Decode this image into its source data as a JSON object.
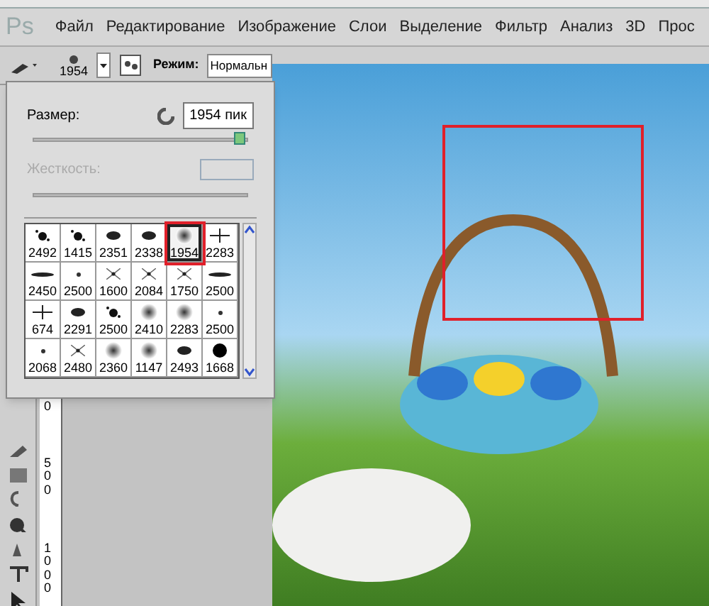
{
  "app_logo": "Ps",
  "menu": [
    "Файл",
    "Редактирование",
    "Изображение",
    "Слои",
    "Выделение",
    "Фильтр",
    "Анализ",
    "3D",
    "Прос"
  ],
  "options_bar": {
    "brush_size": "1954",
    "mode_label": "Режим:",
    "mode_value": "Нормальн"
  },
  "brush_panel": {
    "size_label": "Размер:",
    "size_value": "1954 пик",
    "size_slider": {
      "level": 0.98
    },
    "hardness_label": "Жесткость:",
    "hardness_disabled": true,
    "brushes": [
      {
        "size": "2492",
        "kind": "splat",
        "selected": false
      },
      {
        "size": "1415",
        "kind": "splat",
        "selected": false
      },
      {
        "size": "2351",
        "kind": "blob",
        "selected": false
      },
      {
        "size": "2338",
        "kind": "blob",
        "selected": false
      },
      {
        "size": "1954",
        "kind": "soft",
        "selected": true
      },
      {
        "size": "2283",
        "kind": "cross",
        "selected": false
      },
      {
        "size": "2450",
        "kind": "streak",
        "selected": false
      },
      {
        "size": "2500",
        "kind": "dot",
        "selected": false
      },
      {
        "size": "1600",
        "kind": "star",
        "selected": false
      },
      {
        "size": "2084",
        "kind": "star",
        "selected": false
      },
      {
        "size": "1750",
        "kind": "star",
        "selected": false
      },
      {
        "size": "2500",
        "kind": "streak",
        "selected": false
      },
      {
        "size": "674",
        "kind": "cross",
        "selected": false
      },
      {
        "size": "2291",
        "kind": "blob",
        "selected": false
      },
      {
        "size": "2500",
        "kind": "splat",
        "selected": false
      },
      {
        "size": "2410",
        "kind": "soft",
        "selected": false
      },
      {
        "size": "2283",
        "kind": "soft",
        "selected": false
      },
      {
        "size": "2500",
        "kind": "dot",
        "selected": false
      },
      {
        "size": "2068",
        "kind": "dot",
        "selected": false
      },
      {
        "size": "2480",
        "kind": "star",
        "selected": false
      },
      {
        "size": "2360",
        "kind": "soft",
        "selected": false
      },
      {
        "size": "1147",
        "kind": "soft",
        "selected": false
      },
      {
        "size": "2493",
        "kind": "blob",
        "selected": false
      },
      {
        "size": "1668",
        "kind": "hard",
        "selected": false
      }
    ]
  },
  "ruler_labels": [
    "0",
    "500",
    "1000"
  ]
}
